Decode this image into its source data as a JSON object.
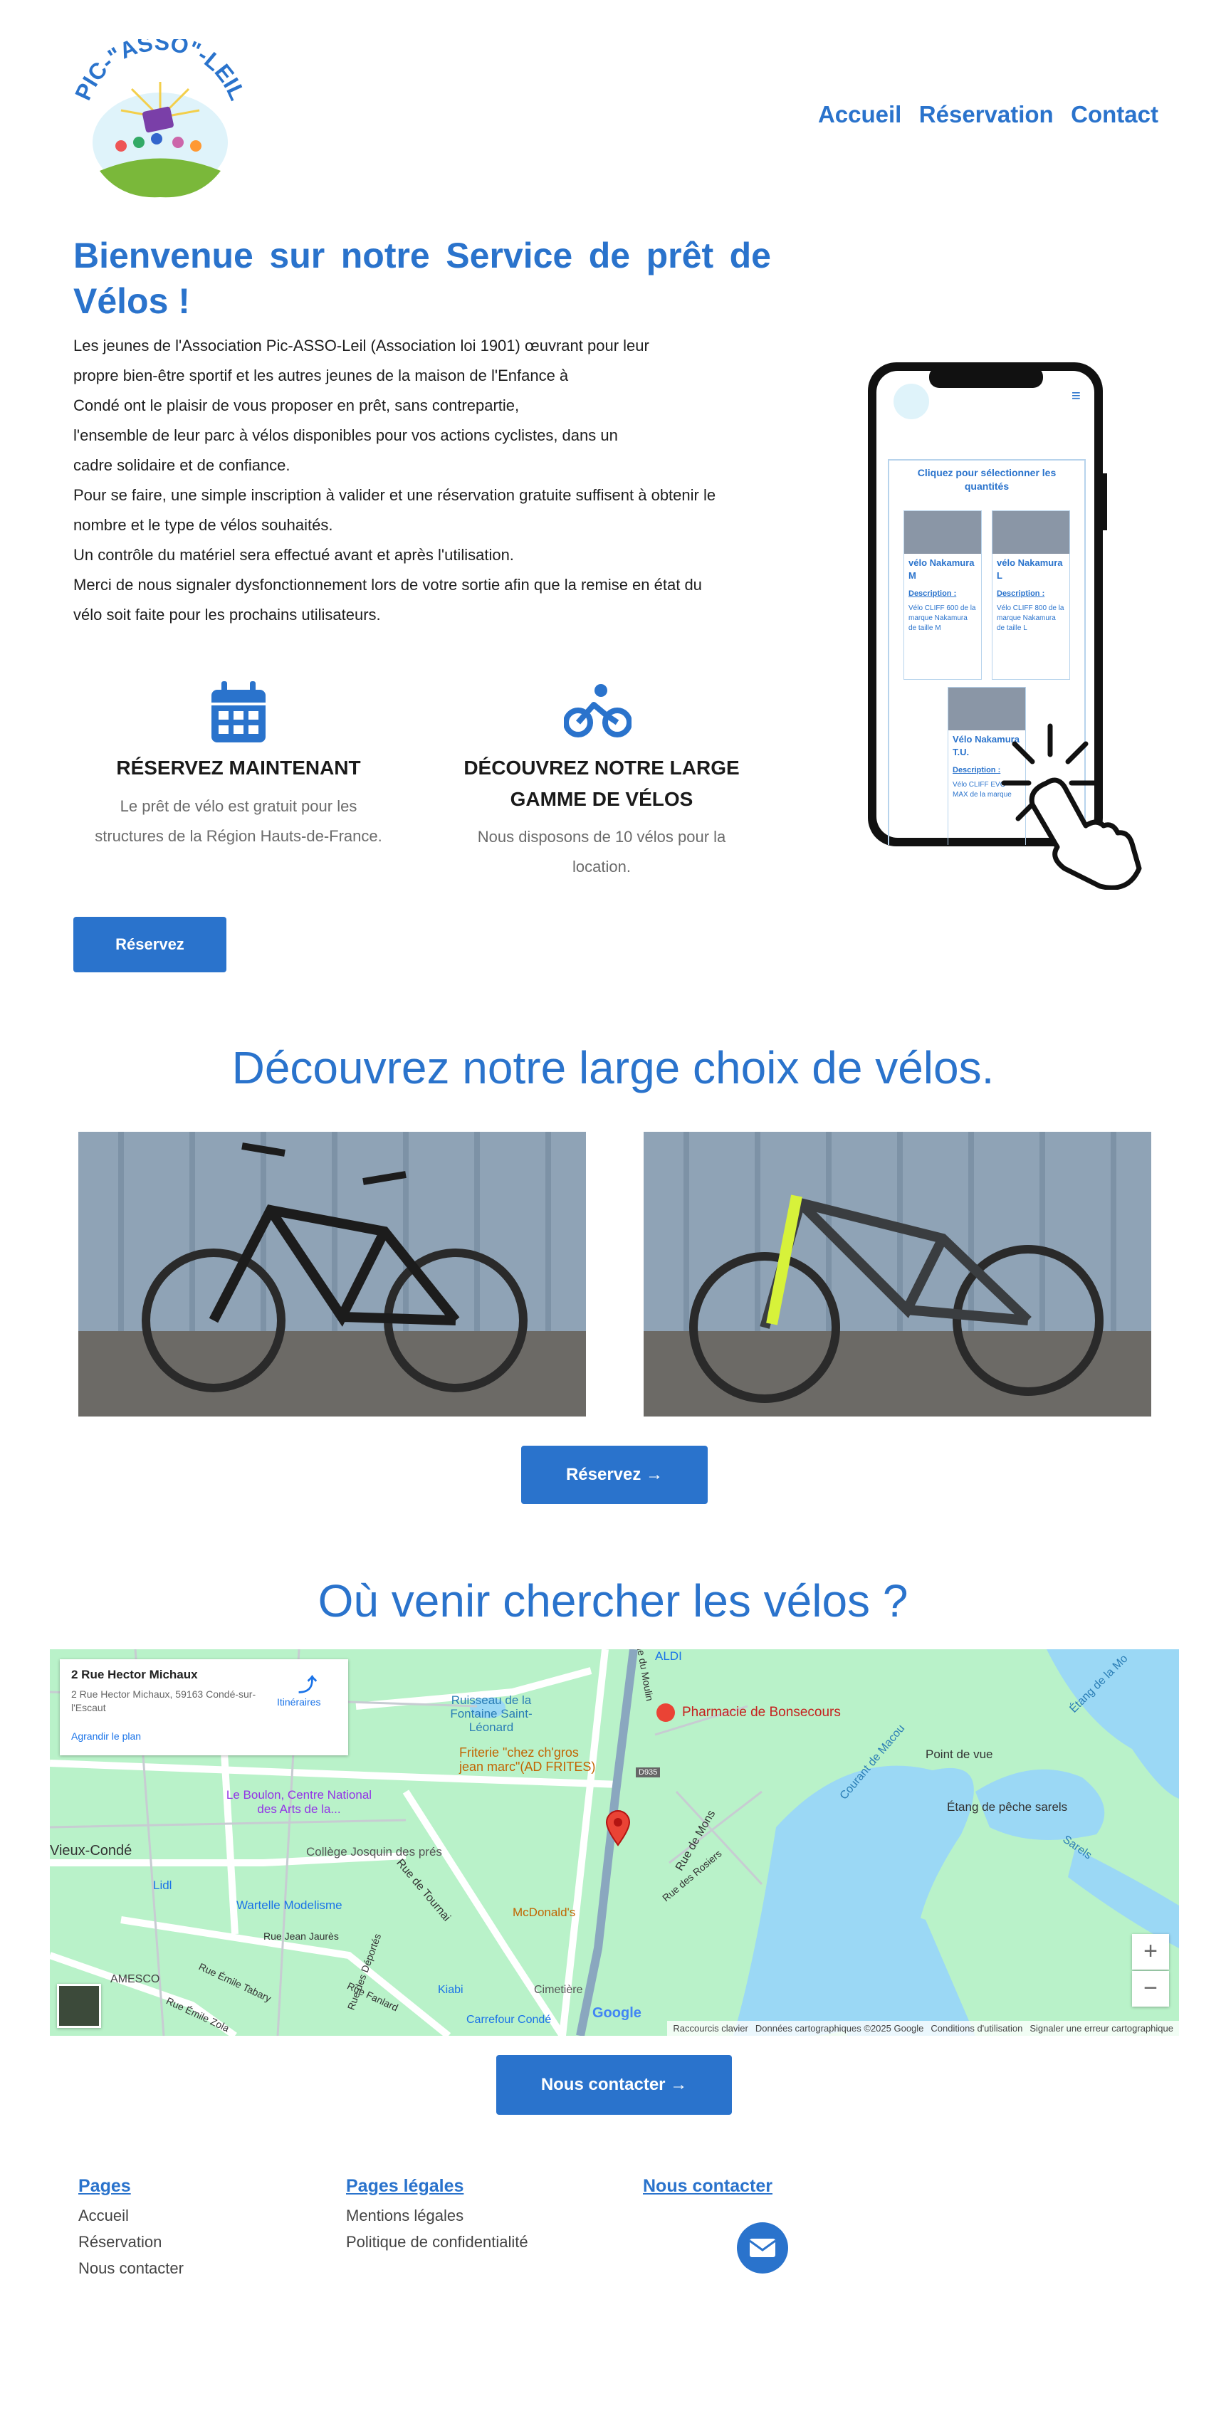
{
  "header": {
    "logo_text": "PIC-\"ASSO\"-LEIL",
    "nav": [
      "Accueil",
      "Réservation",
      "Contact"
    ]
  },
  "hero": {
    "title": "Bienvenue sur notre Service de prêt de Vélos !",
    "paragraph": [
      "Les jeunes de l'Association Pic-ASSO-Leil (Association loi 1901) œuvrant pour leur",
      "propre bien-être sportif et les autres jeunes de la maison de l'Enfance à",
      "Condé ont le plaisir de vous proposer en prêt, sans contrepartie,",
      "l'ensemble de leur parc à vélos disponibles pour vos actions cyclistes, dans un",
      "cadre solidaire et de confiance.",
      "Pour se faire, une simple inscription à valider et une réservation gratuite suffisent à obtenir le",
      "nombre et le type de vélos souhaités.",
      "Un contrôle du matériel sera effectué avant et après l'utilisation.",
      "Merci de nous signaler dysfonctionnement lors de votre sortie afin que la remise en état du",
      "vélo soit faite pour les prochains utilisateurs."
    ]
  },
  "features": [
    {
      "icon": "calendar-icon",
      "title": "RÉSERVEZ MAINTENANT",
      "text_lines": [
        "Le prêt de vélo est gratuit pour les",
        "structures de la Région Hauts-de-France."
      ]
    },
    {
      "icon": "bicycle-icon",
      "title_lines": [
        "DÉCOUVREZ NOTRE LARGE",
        "GAMME DE VÉLOS"
      ],
      "text_lines": [
        "Nous disposons de 10 vélos pour la",
        "location."
      ]
    }
  ],
  "reserve_button": "Réservez",
  "phone": {
    "box_title": "Cliquez pour sélectionner les quantités",
    "items": [
      {
        "name": "vélo Nakamura M",
        "link": "Description :",
        "desc": "Vélo CLIFF 600 de la marque Nakamura de taille M"
      },
      {
        "name": "vélo Nakamura L",
        "link": "Description :",
        "desc": "Vélo CLIFF 800 de la marque Nakamura de taille L"
      },
      {
        "name": "Vélo Nakamura T.U.",
        "link": "Description :",
        "desc": "Vélo CLIFF EVO MAX de la marque"
      }
    ]
  },
  "bikes_section": {
    "title": "Découvrez notre large choix de vélos.",
    "button": "Réservez →"
  },
  "map_section": {
    "title": "Où venir chercher les vélos ?",
    "card_title": "2 Rue Hector Michaux",
    "card_address": "2 Rue Hector Michaux, 59163 Condé-sur-l'Escaut",
    "card_link": "Agrandir le plan",
    "directions": "Itinéraires",
    "labels": {
      "aldi": "ALDI",
      "pharmacie": "Pharmacie de Bonsecours",
      "ruisseau": "Ruisseau de la Fontaine Saint-Léonard",
      "friterie": "Friterie \"chez ch'gros jean marc\"(AD FRITES)",
      "boulon": "Le Boulon, Centre National des Arts de la...",
      "vieux": "Vieux-Condé",
      "college": "Collège Josquin des prés",
      "lidl": "Lidl",
      "wartelle": "Wartelle Modelisme",
      "mcdo": "McDonald's",
      "amesco": "AMESCO",
      "kiabi": "Kiabi",
      "cimetiere": "Cimetière",
      "carrefour": "Carrefour Condé",
      "point_vue": "Point de vue",
      "etang_peche": "Étang de pêche sarels",
      "sarels": "Sarels",
      "courant": "Courant de Macou",
      "etang_de": "Étang de la Mo",
      "rue_mons": "Rue de Mons",
      "rue_tournai": "Rue de Tournai",
      "rue_rosiers": "Rue des Rosiers",
      "rue_jaures": "Rue Jean Jaurès",
      "rue_tabary": "Rue Émile Tabary",
      "rue_zola": "Rue Émile Zola",
      "rue_fanlard": "Rue Fanlard",
      "rue_depo": "Rue des Déportés",
      "rue_moulin": "Rue du Moulin",
      "d935": "D935",
      "google": "Google",
      "footer": [
        "Raccourcis clavier",
        "Données cartographiques ©2025 Google",
        "Conditions d'utilisation",
        "Signaler une erreur cartographique"
      ]
    },
    "contact_button": "Nous contacter →"
  },
  "footer": {
    "col1_title": "Pages",
    "col1_links": [
      "Accueil",
      "Réservation",
      "Nous contacter"
    ],
    "col2_title": "Pages légales",
    "col2_links": [
      "Mentions légales",
      "Politique de confidentialité"
    ],
    "col3_title": "Nous contacter"
  },
  "colors": {
    "accent": "#2a73cc",
    "map_water": "#9bd8f5",
    "map_land": "#b9f2c9"
  }
}
